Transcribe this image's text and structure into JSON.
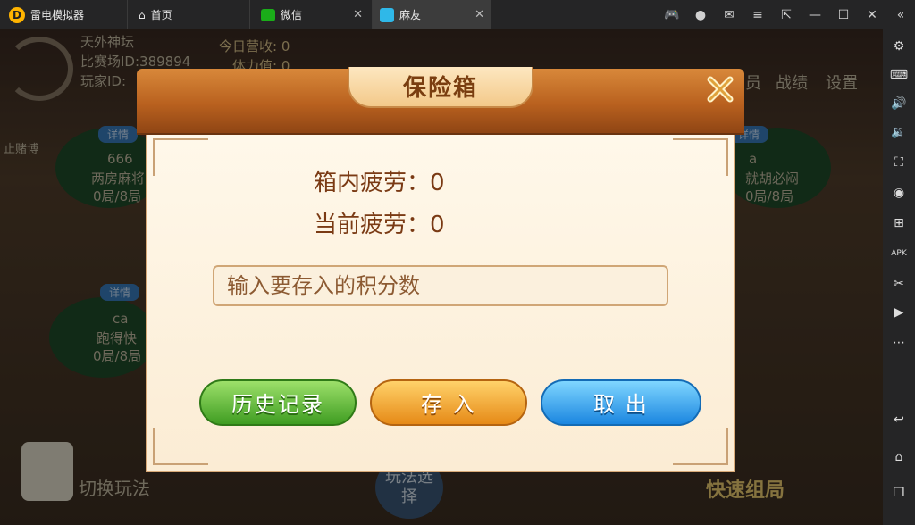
{
  "titlebar": {
    "app_name": "雷电模拟器",
    "tabs": [
      {
        "label": "首页"
      },
      {
        "label": "微信"
      },
      {
        "label": "麻友"
      }
    ]
  },
  "background": {
    "club_name": "天外神坛",
    "match_id": "比赛场ID:389894",
    "player_id": "玩家ID:",
    "today_income": "今日营收: 0",
    "fatigue_short": "体力值: 0",
    "right_menu": [
      "员",
      "战绩",
      "设置"
    ],
    "detail_tag": "详情",
    "stop_label": "止赌博",
    "tables": [
      {
        "name": "666",
        "mode": "两房麻将",
        "rounds": "0局/8局"
      },
      {
        "name": "ca",
        "mode": "跑得快",
        "rounds": "0局/8局"
      },
      {
        "name": "a",
        "mode": "就胡必闷",
        "rounds": "0局/8局"
      }
    ],
    "switch_mode": "切换玩法",
    "play_select": "玩法选择",
    "quick_start": "快速组局"
  },
  "dialog": {
    "title": "保险箱",
    "box_fatigue": "箱内疲劳：0",
    "current_fatigue": "当前疲劳：0",
    "input_placeholder": "输入要存入的积分数",
    "input_value": "",
    "buttons": {
      "history": "历史记录",
      "deposit": "存 入",
      "withdraw": "取 出"
    }
  }
}
